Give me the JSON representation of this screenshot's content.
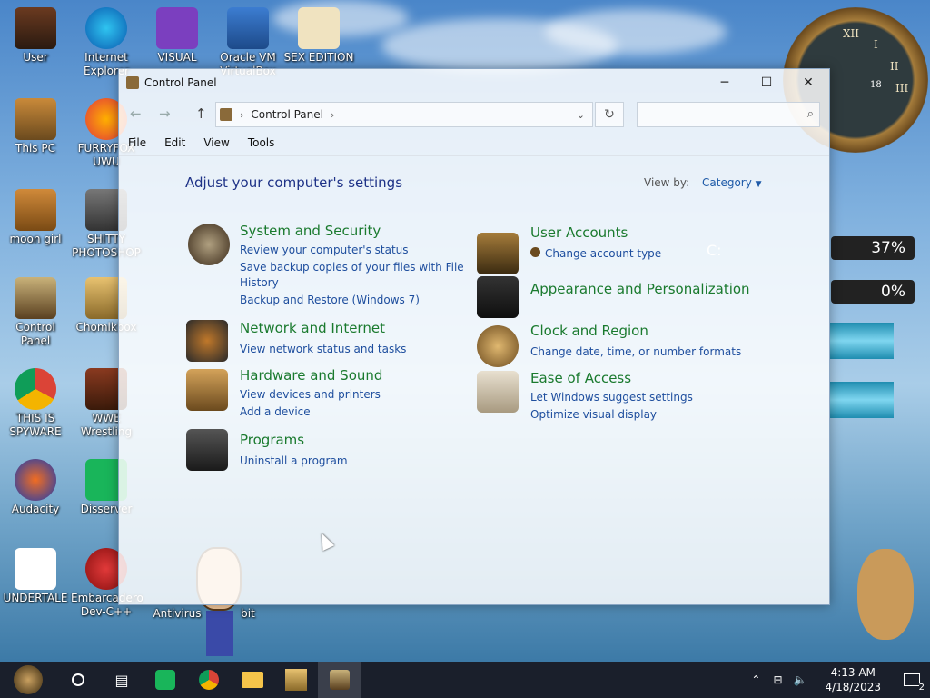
{
  "desktop_icons": [
    {
      "label": "User"
    },
    {
      "label": "Internet Explorer"
    },
    {
      "label": "VISUAL"
    },
    {
      "label": "Oracle VM VirtualBox"
    },
    {
      "label": "SEX EDITION"
    },
    {
      "label": "This PC"
    },
    {
      "label": "FURRYFOX UWU"
    },
    {
      "label": "moon girl"
    },
    {
      "label": "SHITTY PHOTOSHOP"
    },
    {
      "label": "Control Panel"
    },
    {
      "label": "Chomikbox"
    },
    {
      "label": "THIS IS SPYWARE"
    },
    {
      "label": "WWE Wrestling"
    },
    {
      "label": "Audacity"
    },
    {
      "label": "Disserver"
    },
    {
      "label": "UNDERTALE"
    },
    {
      "label": "Embarcadero Dev-C++"
    },
    {
      "label": "Antivirus"
    },
    {
      "label": "bit"
    }
  ],
  "window": {
    "title": "Control Panel",
    "minimize": "─",
    "maximize": "☐",
    "close": "✕",
    "address": "Control Panel",
    "menu": [
      "File",
      "Edit",
      "View",
      "Tools"
    ],
    "heading": "Adjust your computer's settings",
    "view_by_label": "View by:",
    "view_by_value": "Category"
  },
  "categories": {
    "system": {
      "title": "System and Security",
      "links": [
        "Review your computer's status",
        "Save backup copies of your files with File",
        "History",
        "Backup and Restore (Windows 7)"
      ]
    },
    "network": {
      "title": "Network and Internet",
      "links": [
        "View network status and tasks"
      ]
    },
    "hardware": {
      "title": "Hardware and Sound",
      "links": [
        "View devices and printers",
        "Add a device"
      ]
    },
    "programs": {
      "title": "Programs",
      "links": [
        "Uninstall a program"
      ]
    },
    "accounts": {
      "title": "User Accounts",
      "links": [
        "Change account type"
      ]
    },
    "appearance": {
      "title": "Appearance and Personalization",
      "links": []
    },
    "clock": {
      "title": "Clock and Region",
      "links": [
        "Change date, time, or number formats"
      ]
    },
    "ease": {
      "title": "Ease of Access",
      "links": [
        "Let Windows suggest settings",
        "Optimize visual display"
      ]
    }
  },
  "gadgets": {
    "cpu_percent": "37%",
    "ram_percent": "0%",
    "drive_letter": "C:",
    "clock_numerals": [
      "XII",
      "I",
      "II",
      "III"
    ],
    "clock_date": "18"
  },
  "taskbar": {
    "time": "4:13 AM",
    "date": "4/18/2023",
    "notifications": "2"
  },
  "colors": {
    "category_title": "#1a7a2e",
    "link": "#1e4e9e",
    "heading": "#1e3287",
    "taskbar": "#1a1f2b"
  }
}
